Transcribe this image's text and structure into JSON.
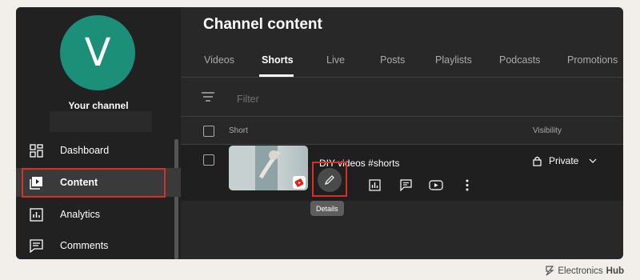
{
  "sidebar": {
    "avatar_letter": "V",
    "your_channel": "Your channel",
    "items": [
      {
        "label": "Dashboard",
        "icon": "dashboard-icon"
      },
      {
        "label": "Content",
        "icon": "content-icon",
        "active": true
      },
      {
        "label": "Analytics",
        "icon": "analytics-icon"
      },
      {
        "label": "Comments",
        "icon": "comments-icon"
      }
    ]
  },
  "main": {
    "title": "Channel content",
    "tabs": [
      "Videos",
      "Shorts",
      "Live",
      "Posts",
      "Playlists",
      "Podcasts",
      "Promotions"
    ],
    "active_tab": "Shorts",
    "filter_placeholder": "Filter",
    "columns": {
      "short": "Short",
      "visibility": "Visibility"
    },
    "rows": [
      {
        "title": "DIY videos #shorts",
        "visibility": "Private"
      }
    ],
    "tooltip": "Details"
  },
  "watermark": {
    "text_1": "Electronics",
    "text_2": "Hub"
  },
  "colors": {
    "accent_red": "#d93025",
    "avatar": "#1b8f78",
    "background": "#282828"
  }
}
